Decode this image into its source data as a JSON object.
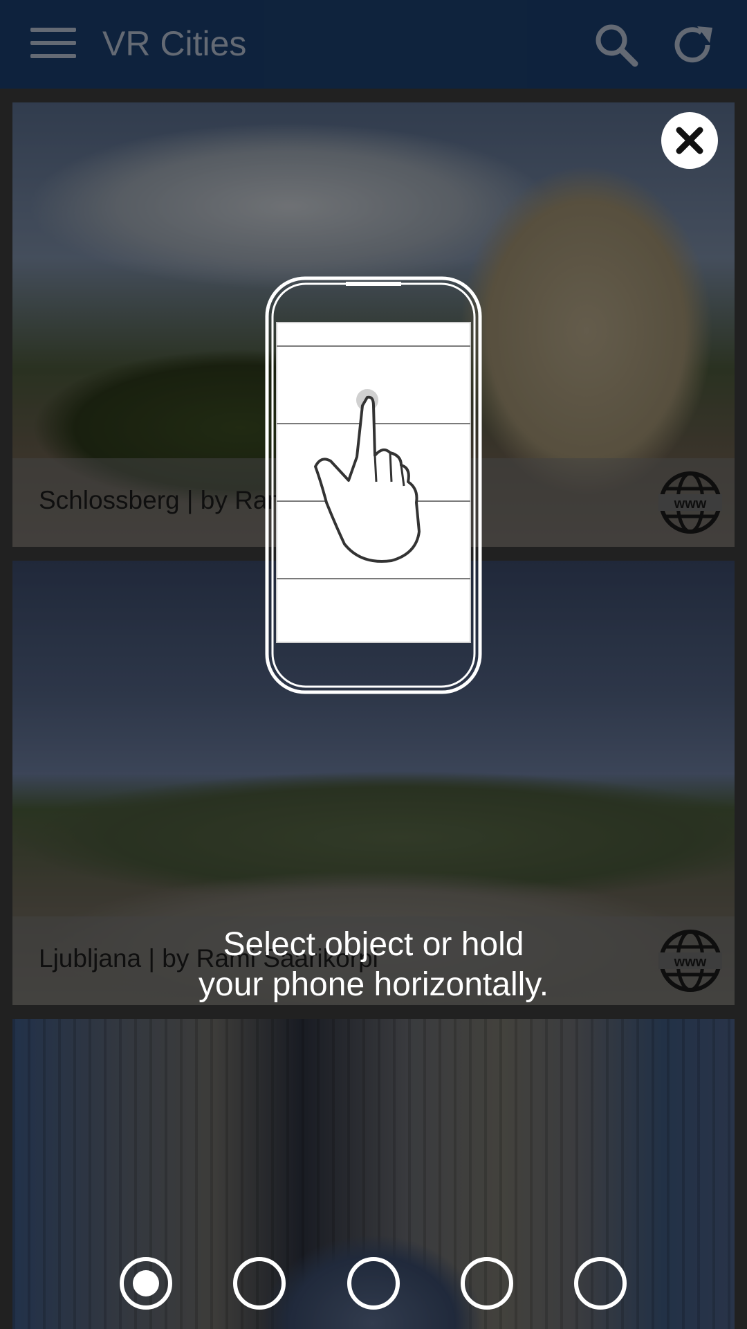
{
  "app": {
    "title": "VR Cities",
    "icons": [
      "menu-icon",
      "search-icon",
      "refresh-icon"
    ]
  },
  "cards": [
    {
      "caption": "Schlossberg | by Rami Saarikorpi",
      "link_icon": "www-globe-icon"
    },
    {
      "caption": "Ljubljana | by Rami Saarikorpi",
      "link_icon": "www-globe-icon"
    },
    {
      "caption": "",
      "link_icon": ""
    }
  ],
  "tutorial": {
    "line1": "Select object or hold",
    "line2": "your phone horizontally.",
    "close_icon": "close-icon",
    "illustration": "phone-tap-hand-icon",
    "pages": 5,
    "active_page": 1
  },
  "colors": {
    "appbar": "#1b3f70",
    "appbar_text": "#b6c2d3",
    "overlay_text": "#ffffff"
  }
}
